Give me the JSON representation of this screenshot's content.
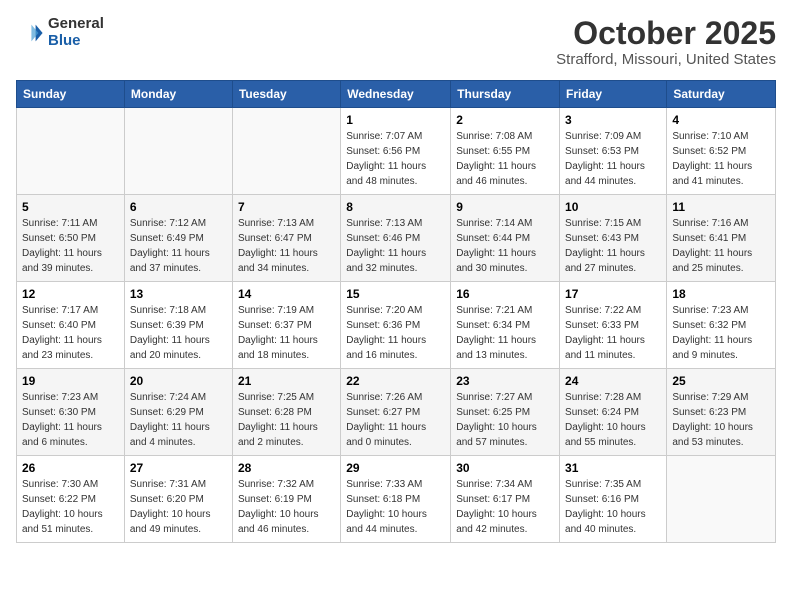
{
  "logo": {
    "general": "General",
    "blue": "Blue"
  },
  "title": "October 2025",
  "location": "Strafford, Missouri, United States",
  "days_of_week": [
    "Sunday",
    "Monday",
    "Tuesday",
    "Wednesday",
    "Thursday",
    "Friday",
    "Saturday"
  ],
  "weeks": [
    [
      {
        "day": "",
        "detail": ""
      },
      {
        "day": "",
        "detail": ""
      },
      {
        "day": "",
        "detail": ""
      },
      {
        "day": "1",
        "detail": "Sunrise: 7:07 AM\nSunset: 6:56 PM\nDaylight: 11 hours and 48 minutes."
      },
      {
        "day": "2",
        "detail": "Sunrise: 7:08 AM\nSunset: 6:55 PM\nDaylight: 11 hours and 46 minutes."
      },
      {
        "day": "3",
        "detail": "Sunrise: 7:09 AM\nSunset: 6:53 PM\nDaylight: 11 hours and 44 minutes."
      },
      {
        "day": "4",
        "detail": "Sunrise: 7:10 AM\nSunset: 6:52 PM\nDaylight: 11 hours and 41 minutes."
      }
    ],
    [
      {
        "day": "5",
        "detail": "Sunrise: 7:11 AM\nSunset: 6:50 PM\nDaylight: 11 hours and 39 minutes."
      },
      {
        "day": "6",
        "detail": "Sunrise: 7:12 AM\nSunset: 6:49 PM\nDaylight: 11 hours and 37 minutes."
      },
      {
        "day": "7",
        "detail": "Sunrise: 7:13 AM\nSunset: 6:47 PM\nDaylight: 11 hours and 34 minutes."
      },
      {
        "day": "8",
        "detail": "Sunrise: 7:13 AM\nSunset: 6:46 PM\nDaylight: 11 hours and 32 minutes."
      },
      {
        "day": "9",
        "detail": "Sunrise: 7:14 AM\nSunset: 6:44 PM\nDaylight: 11 hours and 30 minutes."
      },
      {
        "day": "10",
        "detail": "Sunrise: 7:15 AM\nSunset: 6:43 PM\nDaylight: 11 hours and 27 minutes."
      },
      {
        "day": "11",
        "detail": "Sunrise: 7:16 AM\nSunset: 6:41 PM\nDaylight: 11 hours and 25 minutes."
      }
    ],
    [
      {
        "day": "12",
        "detail": "Sunrise: 7:17 AM\nSunset: 6:40 PM\nDaylight: 11 hours and 23 minutes."
      },
      {
        "day": "13",
        "detail": "Sunrise: 7:18 AM\nSunset: 6:39 PM\nDaylight: 11 hours and 20 minutes."
      },
      {
        "day": "14",
        "detail": "Sunrise: 7:19 AM\nSunset: 6:37 PM\nDaylight: 11 hours and 18 minutes."
      },
      {
        "day": "15",
        "detail": "Sunrise: 7:20 AM\nSunset: 6:36 PM\nDaylight: 11 hours and 16 minutes."
      },
      {
        "day": "16",
        "detail": "Sunrise: 7:21 AM\nSunset: 6:34 PM\nDaylight: 11 hours and 13 minutes."
      },
      {
        "day": "17",
        "detail": "Sunrise: 7:22 AM\nSunset: 6:33 PM\nDaylight: 11 hours and 11 minutes."
      },
      {
        "day": "18",
        "detail": "Sunrise: 7:23 AM\nSunset: 6:32 PM\nDaylight: 11 hours and 9 minutes."
      }
    ],
    [
      {
        "day": "19",
        "detail": "Sunrise: 7:23 AM\nSunset: 6:30 PM\nDaylight: 11 hours and 6 minutes."
      },
      {
        "day": "20",
        "detail": "Sunrise: 7:24 AM\nSunset: 6:29 PM\nDaylight: 11 hours and 4 minutes."
      },
      {
        "day": "21",
        "detail": "Sunrise: 7:25 AM\nSunset: 6:28 PM\nDaylight: 11 hours and 2 minutes."
      },
      {
        "day": "22",
        "detail": "Sunrise: 7:26 AM\nSunset: 6:27 PM\nDaylight: 11 hours and 0 minutes."
      },
      {
        "day": "23",
        "detail": "Sunrise: 7:27 AM\nSunset: 6:25 PM\nDaylight: 10 hours and 57 minutes."
      },
      {
        "day": "24",
        "detail": "Sunrise: 7:28 AM\nSunset: 6:24 PM\nDaylight: 10 hours and 55 minutes."
      },
      {
        "day": "25",
        "detail": "Sunrise: 7:29 AM\nSunset: 6:23 PM\nDaylight: 10 hours and 53 minutes."
      }
    ],
    [
      {
        "day": "26",
        "detail": "Sunrise: 7:30 AM\nSunset: 6:22 PM\nDaylight: 10 hours and 51 minutes."
      },
      {
        "day": "27",
        "detail": "Sunrise: 7:31 AM\nSunset: 6:20 PM\nDaylight: 10 hours and 49 minutes."
      },
      {
        "day": "28",
        "detail": "Sunrise: 7:32 AM\nSunset: 6:19 PM\nDaylight: 10 hours and 46 minutes."
      },
      {
        "day": "29",
        "detail": "Sunrise: 7:33 AM\nSunset: 6:18 PM\nDaylight: 10 hours and 44 minutes."
      },
      {
        "day": "30",
        "detail": "Sunrise: 7:34 AM\nSunset: 6:17 PM\nDaylight: 10 hours and 42 minutes."
      },
      {
        "day": "31",
        "detail": "Sunrise: 7:35 AM\nSunset: 6:16 PM\nDaylight: 10 hours and 40 minutes."
      },
      {
        "day": "",
        "detail": ""
      }
    ]
  ]
}
